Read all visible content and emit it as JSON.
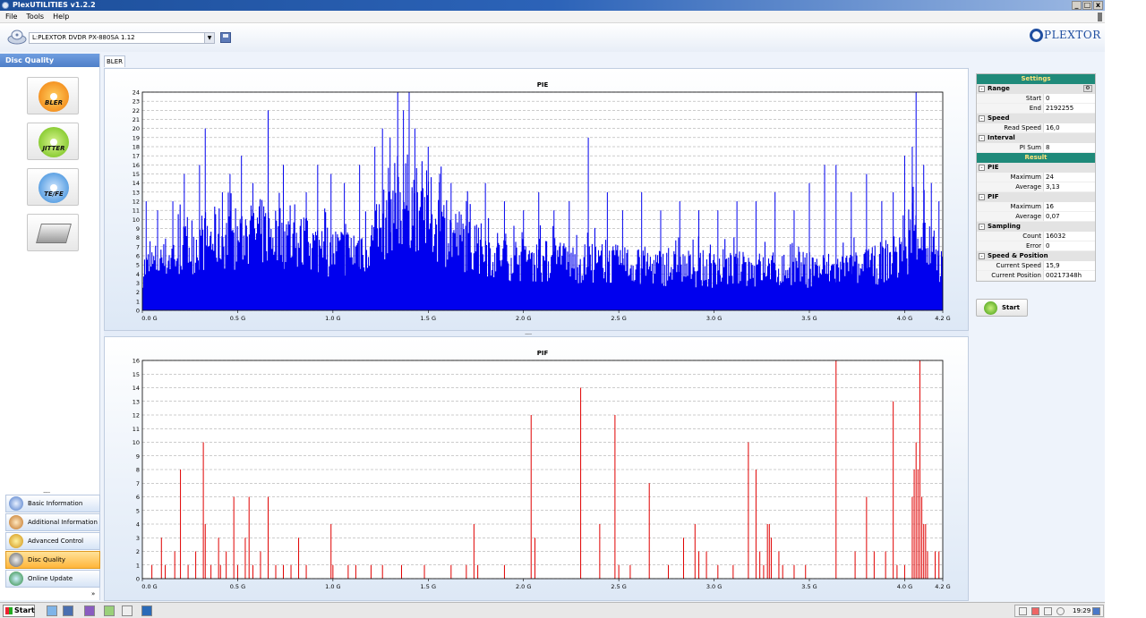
{
  "window": {
    "title": "PlexUTILITIES v1.2.2",
    "controls": [
      "_",
      "□",
      "x"
    ]
  },
  "menu": {
    "file": "File",
    "tools": "Tools",
    "help": "Help"
  },
  "toolbar": {
    "drive": "L:PLEXTOR DVDR  PX-880SA  1.12",
    "brand": "PLEXTOR"
  },
  "leftpanel": {
    "title": "Disc Quality",
    "tests": [
      {
        "label": "BLER",
        "icon": "bler-disc-icon"
      },
      {
        "label": "JITTER",
        "icon": "jitter-disc-icon"
      },
      {
        "label": "TE/FE",
        "icon": "tefe-disc-icon"
      },
      {
        "label": "",
        "icon": "drive-icon"
      }
    ]
  },
  "nav": {
    "items": [
      {
        "label": "Basic Information",
        "icon": "info-icon"
      },
      {
        "label": "Additional Information",
        "icon": "additional-info-icon"
      },
      {
        "label": "Advanced Control",
        "icon": "advanced-control-icon"
      },
      {
        "label": "Disc Quality",
        "icon": "disc-quality-icon"
      },
      {
        "label": "Online Update",
        "icon": "online-update-icon"
      }
    ],
    "active": "Disc Quality"
  },
  "tab": {
    "label": "BLER"
  },
  "settings": {
    "header": "Settings",
    "range": "Range",
    "start_label": "Start",
    "start": "0",
    "end_label": "End",
    "end": "2192255",
    "speed": "Speed",
    "read_speed_label": "Read Speed",
    "read_speed": "16,0",
    "interval": "Interval",
    "pi_sum_label": "PI Sum",
    "pi_sum": "8"
  },
  "result": {
    "header": "Result",
    "pie": "PIE",
    "pie_max_label": "Maximum",
    "pie_max": "24",
    "pie_avg_label": "Average",
    "pie_avg": "3,13",
    "pif": "PIF",
    "pif_max_label": "Maximum",
    "pif_max": "16",
    "pif_avg_label": "Average",
    "pif_avg": "0,07",
    "sampling": "Sampling",
    "count_label": "Count",
    "count": "16032",
    "error_label": "Error",
    "error": "0",
    "speedpos": "Speed & Position",
    "cur_speed_label": "Current Speed",
    "cur_speed": "15,9",
    "cur_pos_label": "Current Position",
    "cur_pos": "00217348h"
  },
  "buttons": {
    "start": "Start"
  },
  "taskbar": {
    "start": "Start",
    "clock": "19:29"
  },
  "colors": {
    "pie": "#0000ee",
    "pif": "#e00000",
    "accent": "#1f8a7a"
  },
  "chart_data": [
    {
      "type": "bar",
      "title": "PIE",
      "xlabel": "",
      "ylabel": "",
      "x_ticks": [
        "0.0 G",
        "0.5 G",
        "1.0 G",
        "1.5 G",
        "2.0 G",
        "2.5 G",
        "3.0 G",
        "3.5 G",
        "4.0 G",
        "4.2 G"
      ],
      "x_tick_values": [
        0,
        0.5,
        1.0,
        1.5,
        2.0,
        2.5,
        3.0,
        3.5,
        4.0,
        4.2
      ],
      "xlim": [
        0,
        4.2
      ],
      "ylim": [
        0,
        24
      ],
      "y_ticks": [
        0,
        1,
        2,
        3,
        4,
        5,
        6,
        7,
        8,
        9,
        10,
        11,
        12,
        13,
        14,
        15,
        16,
        17,
        18,
        19,
        20,
        21,
        22,
        23,
        24
      ],
      "grid": true,
      "series": [
        {
          "color": "#0000ee",
          "base_profile": [
            [
              0.0,
              4.5
            ],
            [
              0.1,
              5.5
            ],
            [
              0.2,
              6.5
            ],
            [
              0.3,
              7.5
            ],
            [
              0.4,
              8.0
            ],
            [
              0.5,
              8.0
            ],
            [
              0.6,
              8.5
            ],
            [
              0.7,
              8.5
            ],
            [
              0.8,
              7.5
            ],
            [
              0.9,
              7.0
            ],
            [
              1.0,
              6.5
            ],
            [
              1.1,
              6.5
            ],
            [
              1.2,
              7.5
            ],
            [
              1.26,
              9.0
            ],
            [
              1.3,
              11.5
            ],
            [
              1.4,
              12.0
            ],
            [
              1.5,
              10.5
            ],
            [
              1.6,
              8.5
            ],
            [
              1.7,
              7.5
            ],
            [
              1.8,
              6.5
            ],
            [
              2.0,
              5.5
            ],
            [
              2.5,
              5.0
            ],
            [
              3.0,
              4.5
            ],
            [
              3.5,
              4.5
            ],
            [
              3.8,
              4.5
            ],
            [
              3.9,
              5.5
            ],
            [
              4.0,
              6.0
            ],
            [
              4.05,
              9.5
            ],
            [
              4.1,
              8.0
            ],
            [
              4.15,
              6.0
            ],
            [
              4.2,
              4.5
            ]
          ],
          "spikes": [
            [
              0.02,
              12
            ],
            [
              0.08,
              11
            ],
            [
              0.16,
              12
            ],
            [
              0.22,
              15
            ],
            [
              0.3,
              16
            ],
            [
              0.33,
              20
            ],
            [
              0.42,
              13
            ],
            [
              0.46,
              15
            ],
            [
              0.52,
              17
            ],
            [
              0.58,
              14
            ],
            [
              0.66,
              22
            ],
            [
              0.74,
              16
            ],
            [
              0.86,
              13
            ],
            [
              0.92,
              16
            ],
            [
              0.99,
              15
            ],
            [
              1.06,
              14
            ],
            [
              1.14,
              16
            ],
            [
              1.22,
              18
            ],
            [
              1.26,
              20
            ],
            [
              1.3,
              19
            ],
            [
              1.34,
              24
            ],
            [
              1.37,
              22
            ],
            [
              1.4,
              24
            ],
            [
              1.43,
              20
            ],
            [
              1.5,
              18
            ],
            [
              1.56,
              15
            ],
            [
              1.62,
              14
            ],
            [
              1.7,
              12
            ],
            [
              1.8,
              14
            ],
            [
              1.9,
              12
            ],
            [
              2.0,
              11
            ],
            [
              2.08,
              13
            ],
            [
              2.16,
              11
            ],
            [
              2.24,
              12
            ],
            [
              2.34,
              19
            ],
            [
              2.44,
              13
            ],
            [
              2.52,
              11
            ],
            [
              2.62,
              13
            ],
            [
              2.72,
              11
            ],
            [
              2.82,
              12
            ],
            [
              2.92,
              11
            ],
            [
              3.02,
              11
            ],
            [
              3.12,
              12
            ],
            [
              3.22,
              12
            ],
            [
              3.32,
              13
            ],
            [
              3.42,
              11
            ],
            [
              3.5,
              14
            ],
            [
              3.58,
              16
            ],
            [
              3.64,
              16
            ],
            [
              3.72,
              13
            ],
            [
              3.8,
              15
            ],
            [
              3.88,
              12
            ],
            [
              3.94,
              13
            ],
            [
              4.0,
              17
            ],
            [
              4.04,
              18
            ],
            [
              4.06,
              24
            ],
            [
              4.1,
              16
            ],
            [
              4.14,
              14
            ],
            [
              4.18,
              12
            ]
          ]
        }
      ]
    },
    {
      "type": "bar",
      "title": "PIF",
      "xlabel": "",
      "ylabel": "",
      "x_ticks": [
        "0.0 G",
        "0.5 G",
        "1.0 G",
        "1.5 G",
        "2.0 G",
        "2.5 G",
        "3.0 G",
        "3.5 G",
        "4.0 G",
        "4.2 G"
      ],
      "x_tick_values": [
        0,
        0.5,
        1.0,
        1.5,
        2.0,
        2.5,
        3.0,
        3.5,
        4.0,
        4.2
      ],
      "xlim": [
        0,
        4.2
      ],
      "ylim": [
        0,
        16
      ],
      "y_ticks": [
        0,
        1,
        2,
        3,
        4,
        5,
        6,
        7,
        8,
        9,
        10,
        11,
        12,
        13,
        14,
        15,
        16
      ],
      "grid": true,
      "series": [
        {
          "color": "#e00000",
          "bars": [
            [
              0.05,
              1
            ],
            [
              0.1,
              3
            ],
            [
              0.12,
              1
            ],
            [
              0.17,
              2
            ],
            [
              0.2,
              8
            ],
            [
              0.24,
              1
            ],
            [
              0.28,
              2
            ],
            [
              0.32,
              10
            ],
            [
              0.33,
              4
            ],
            [
              0.36,
              1
            ],
            [
              0.4,
              3
            ],
            [
              0.41,
              1
            ],
            [
              0.44,
              2
            ],
            [
              0.48,
              6
            ],
            [
              0.5,
              1
            ],
            [
              0.54,
              3
            ],
            [
              0.56,
              6
            ],
            [
              0.58,
              1
            ],
            [
              0.62,
              2
            ],
            [
              0.66,
              6
            ],
            [
              0.7,
              1
            ],
            [
              0.74,
              1
            ],
            [
              0.78,
              1
            ],
            [
              0.82,
              3
            ],
            [
              0.86,
              1
            ],
            [
              0.99,
              4
            ],
            [
              1.0,
              1
            ],
            [
              1.08,
              1
            ],
            [
              1.12,
              1
            ],
            [
              1.2,
              1
            ],
            [
              1.26,
              1
            ],
            [
              1.36,
              1
            ],
            [
              1.48,
              1
            ],
            [
              1.62,
              1
            ],
            [
              1.7,
              1
            ],
            [
              1.74,
              4
            ],
            [
              1.76,
              1
            ],
            [
              1.9,
              1
            ],
            [
              2.04,
              12
            ],
            [
              2.06,
              3
            ],
            [
              2.3,
              14
            ],
            [
              2.4,
              4
            ],
            [
              2.48,
              12
            ],
            [
              2.5,
              1
            ],
            [
              2.56,
              1
            ],
            [
              2.66,
              7
            ],
            [
              2.76,
              1
            ],
            [
              2.84,
              3
            ],
            [
              2.9,
              4
            ],
            [
              2.92,
              2
            ],
            [
              2.96,
              2
            ],
            [
              3.02,
              1
            ],
            [
              3.1,
              1
            ],
            [
              3.18,
              10
            ],
            [
              3.22,
              8
            ],
            [
              3.24,
              2
            ],
            [
              3.26,
              1
            ],
            [
              3.28,
              4
            ],
            [
              3.29,
              4
            ],
            [
              3.3,
              3
            ],
            [
              3.34,
              2
            ],
            [
              3.36,
              1
            ],
            [
              3.42,
              1
            ],
            [
              3.48,
              1
            ],
            [
              3.64,
              16
            ],
            [
              3.74,
              2
            ],
            [
              3.8,
              6
            ],
            [
              3.84,
              2
            ],
            [
              3.9,
              2
            ],
            [
              3.94,
              13
            ],
            [
              3.96,
              1
            ],
            [
              4.0,
              1
            ],
            [
              4.04,
              6
            ],
            [
              4.05,
              8
            ],
            [
              4.06,
              10
            ],
            [
              4.07,
              8
            ],
            [
              4.08,
              16
            ],
            [
              4.09,
              6
            ],
            [
              4.1,
              4
            ],
            [
              4.11,
              4
            ],
            [
              4.12,
              2
            ],
            [
              4.16,
              2
            ],
            [
              4.18,
              2
            ]
          ]
        }
      ]
    }
  ]
}
